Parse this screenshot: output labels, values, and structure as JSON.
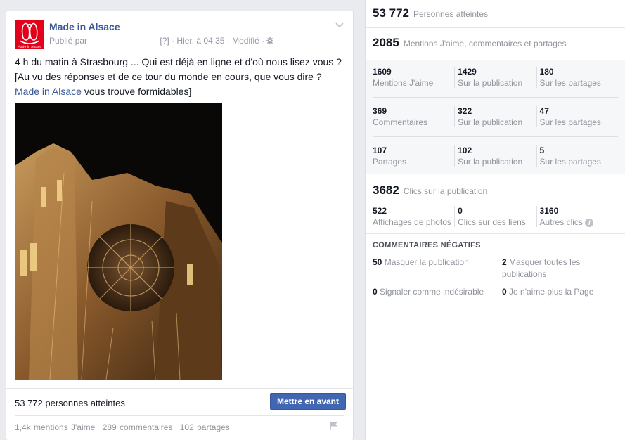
{
  "post": {
    "page_name": "Made in Alsace",
    "published_by": "Publié par",
    "help_marker": "[?]",
    "time": "Hier, à 04:35",
    "edited": "Modifié",
    "text_main": "4 h du matin à Strasbourg ... Qui est déjà en ligne et d'où nous lisez vous ? [Au vu des réponses et de ce tour du monde en cours, que vous dire ? ",
    "text_link": "Made in Alsace",
    "text_end": " vous trouve formidables]",
    "reach_text": "53 772 personnes atteintes",
    "promote_label": "Mettre en avant",
    "likes": "1,4k mentions J'aime",
    "comments": "289 commentaires",
    "shares": "102 partages",
    "logo_caption": "Made In Alsace"
  },
  "insights": {
    "reach_num": "53 772",
    "reach_label": "Personnes atteintes",
    "engagement_num": "2085",
    "engagement_label": "Mentions J'aime, commentaires et partages",
    "rows": [
      [
        {
          "n": "1609",
          "l": "Mentions J'aime"
        },
        {
          "n": "1429",
          "l": "Sur la publication"
        },
        {
          "n": "180",
          "l": "Sur les partages"
        }
      ],
      [
        {
          "n": "369",
          "l": "Commentaires"
        },
        {
          "n": "322",
          "l": "Sur la publication"
        },
        {
          "n": "47",
          "l": "Sur les partages"
        }
      ],
      [
        {
          "n": "107",
          "l": "Partages"
        },
        {
          "n": "102",
          "l": "Sur la publication"
        },
        {
          "n": "5",
          "l": "Sur les partages"
        }
      ]
    ],
    "clicks_num": "3682",
    "clicks_label": "Clics sur la publication",
    "click_row": [
      {
        "n": "522",
        "l": "Affichages de photos"
      },
      {
        "n": "0",
        "l": "Clics sur des liens"
      },
      {
        "n": "3160",
        "l": "Autres clics"
      }
    ],
    "negative_title": "COMMENTAIRES NÉGATIFS",
    "negative": [
      {
        "n": "50",
        "l": "Masquer la publication"
      },
      {
        "n": "2",
        "l": "Masquer toutes les publications"
      },
      {
        "n": "0",
        "l": "Signaler comme indésirable"
      },
      {
        "n": "0",
        "l": "Je n'aime plus la Page"
      }
    ]
  },
  "colors": {
    "brand": "#3b5998",
    "button": "#4267b2",
    "logo_red": "#e2001a"
  }
}
